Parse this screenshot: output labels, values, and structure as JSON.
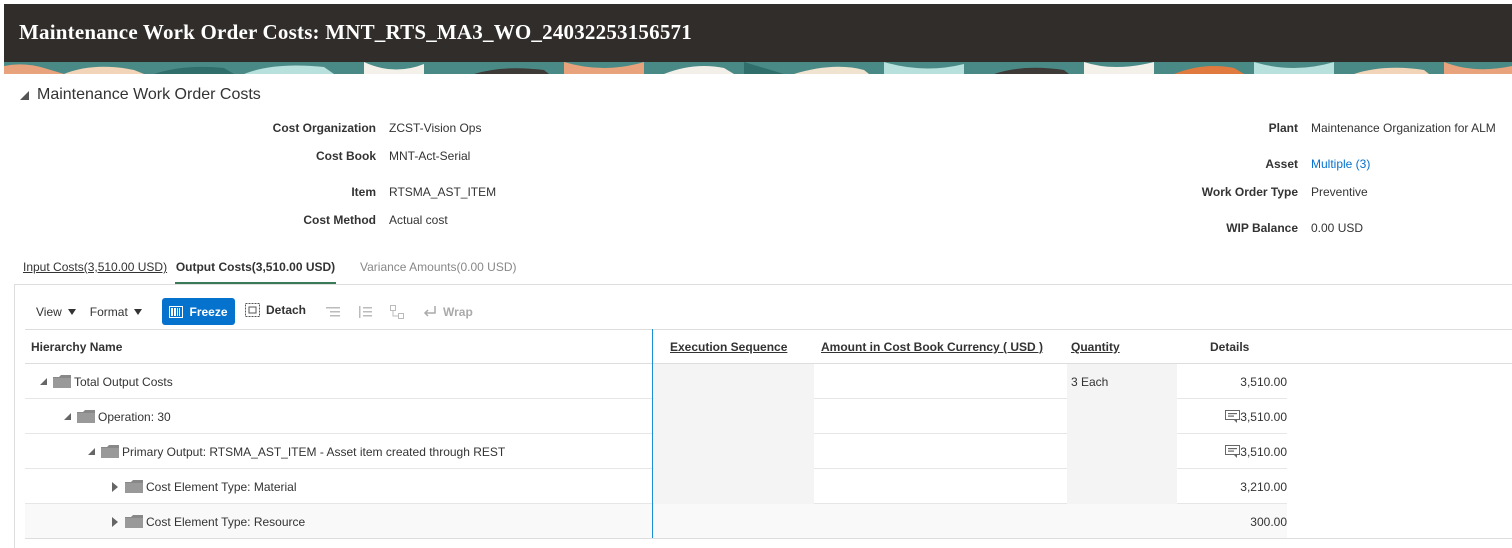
{
  "header": {
    "title": "Maintenance Work Order Costs: MNT_RTS_MA3_WO_24032253156571"
  },
  "section": {
    "title": "Maintenance Work Order Costs"
  },
  "fields": {
    "cost_org_label": "Cost Organization",
    "cost_org_value": "ZCST-Vision Ops",
    "cost_book_label": "Cost Book",
    "cost_book_value": "MNT-Act-Serial",
    "item_label": "Item",
    "item_value": "RTSMA_AST_ITEM",
    "cost_method_label": "Cost Method",
    "cost_method_value": "Actual cost",
    "plant_label": "Plant",
    "plant_value": "Maintenance Organization for ALM",
    "asset_label": "Asset",
    "asset_value": "Multiple (3)",
    "wo_type_label": "Work Order Type",
    "wo_type_value": "Preventive",
    "wip_label": "WIP Balance",
    "wip_value": "0.00 USD"
  },
  "tabs": {
    "input": "Input Costs(3,510.00 USD)",
    "output": "Output Costs(3,510.00 USD)",
    "variance": "Variance Amounts(0.00 USD)"
  },
  "toolbar": {
    "view": "View",
    "format": "Format",
    "freeze": "Freeze",
    "detach": "Detach",
    "wrap": "Wrap"
  },
  "table": {
    "columns": {
      "hierarchy": "Hierarchy Name",
      "execution": "Execution Sequence",
      "amount": "Amount in Cost Book Currency ( USD )",
      "quantity": "Quantity",
      "details": "Details"
    },
    "rows": [
      {
        "name": "Total Output Costs",
        "amount": "3,510.00",
        "quantity": "3 Each"
      },
      {
        "name": "Operation: 30",
        "amount": "3,510.00",
        "quantity": ""
      },
      {
        "name": "Primary Output: RTSMA_AST_ITEM - Asset item created through REST",
        "amount": "3,510.00",
        "quantity": ""
      },
      {
        "name": "Cost Element Type: Material",
        "amount": "3,210.00",
        "quantity": ""
      },
      {
        "name": "Cost Element Type: Resource",
        "amount": "300.00",
        "quantity": ""
      }
    ]
  },
  "colors": {
    "header_bg": "#312d2a",
    "accent_blue": "#0572ce",
    "tab_underline": "#3b7a57"
  }
}
